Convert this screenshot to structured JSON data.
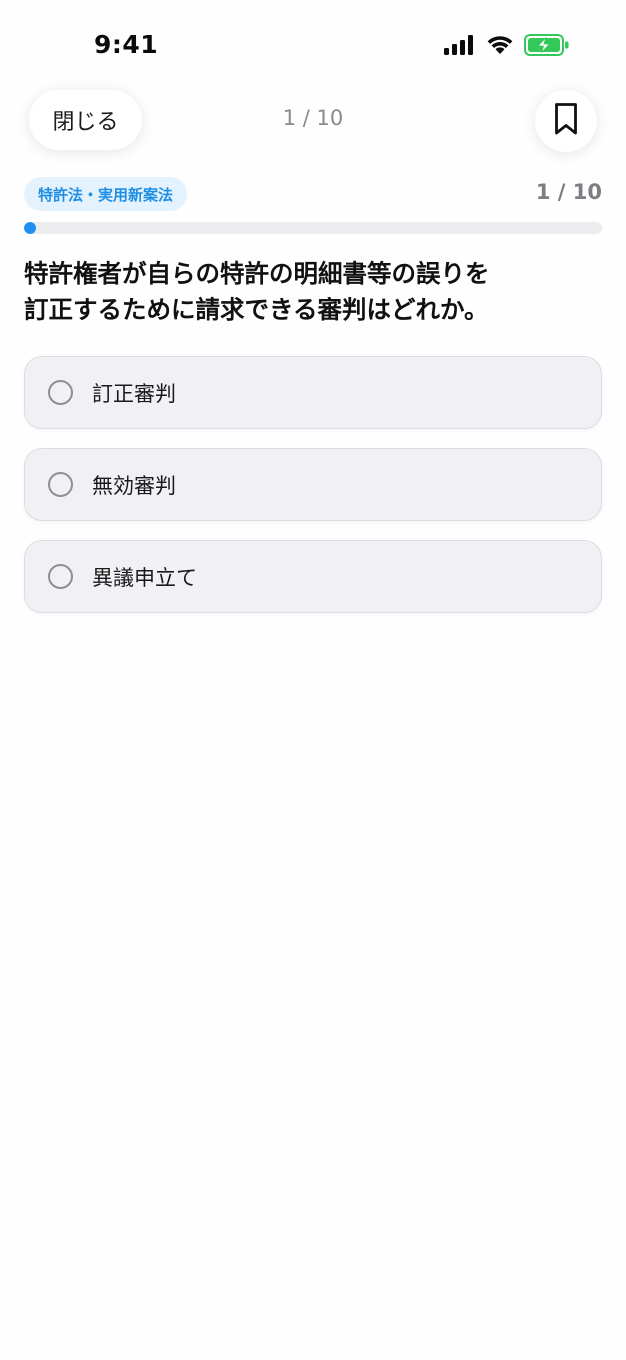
{
  "status_bar": {
    "time": "9:41",
    "icons": [
      "cellular-signal-icon",
      "wifi-icon",
      "battery-charging-icon"
    ],
    "battery_color": "#34c759"
  },
  "header": {
    "close_label": "閉じる",
    "counter": "1 / 10",
    "bookmark_icon": "bookmark-icon"
  },
  "quiz": {
    "category": "特許法・実用新案法",
    "counter": "1 / 10",
    "progress_fraction": 0.0,
    "question_line1": "特許権者が自らの特許の明細書等の誤りを",
    "question_line2": "訂正するために請求できる審判はどれか。",
    "choices": [
      {
        "label": "訂正審判",
        "selected": false
      },
      {
        "label": "無効審判",
        "selected": false
      },
      {
        "label": "異議申立て",
        "selected": false
      }
    ]
  },
  "colors": {
    "accent": "#1e8ff0",
    "badge_bg": "#e4f2fd",
    "choice_bg": "#f1f1f5",
    "muted_text": "#8a8a8e"
  }
}
